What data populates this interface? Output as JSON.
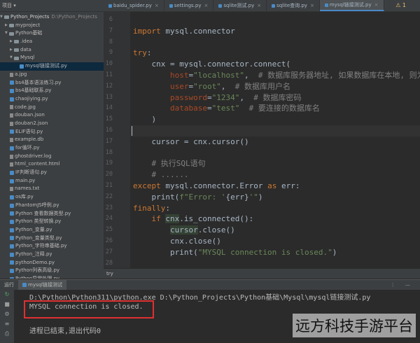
{
  "sidebar": {
    "header": "项目 ▾",
    "root": {
      "name": "Python_Projects",
      "path": "D:\\Python_Projects"
    },
    "items": [
      {
        "label": "myproject",
        "kind": "folder",
        "indent": 1,
        "expanded": false
      },
      {
        "label": "Python基础",
        "kind": "folder",
        "indent": 1,
        "expanded": true
      },
      {
        "label": ".idea",
        "kind": "folder",
        "indent": 2,
        "expanded": false
      },
      {
        "label": "data",
        "kind": "folder",
        "indent": 2,
        "expanded": false
      },
      {
        "label": "Mysql",
        "kind": "folder",
        "indent": 2,
        "expanded": true
      },
      {
        "label": "mysql链接测试.py",
        "kind": "py",
        "indent": 4,
        "selected": true
      },
      {
        "label": "a.jpg",
        "kind": "file",
        "indent": 2
      },
      {
        "label": "bs4基本语法练习.py",
        "kind": "py",
        "indent": 2
      },
      {
        "label": "bs4基础联系.py",
        "kind": "py",
        "indent": 2
      },
      {
        "label": "chaojiying.py",
        "kind": "py",
        "indent": 2
      },
      {
        "label": "code.jpg",
        "kind": "file",
        "indent": 2
      },
      {
        "label": "douban.json",
        "kind": "file",
        "indent": 2
      },
      {
        "label": "douban2.json",
        "kind": "file",
        "indent": 2
      },
      {
        "label": "ELIF语句.py",
        "kind": "py",
        "indent": 2
      },
      {
        "label": "example.db",
        "kind": "file",
        "indent": 2
      },
      {
        "label": "for循环.py",
        "kind": "py",
        "indent": 2
      },
      {
        "label": "ghostdriver.log",
        "kind": "file",
        "indent": 2
      },
      {
        "label": "html_content.html",
        "kind": "file",
        "indent": 2
      },
      {
        "label": "IF判断语句.py",
        "kind": "py",
        "indent": 2
      },
      {
        "label": "main.py",
        "kind": "py",
        "indent": 2
      },
      {
        "label": "names.txt",
        "kind": "file",
        "indent": 2
      },
      {
        "label": "os库.py",
        "kind": "py",
        "indent": 2
      },
      {
        "label": "PhantomJS呼例.py",
        "kind": "py",
        "indent": 2
      },
      {
        "label": "Python 查看数据类型.py",
        "kind": "py",
        "indent": 2
      },
      {
        "label": "Python 类型转换.py",
        "kind": "py",
        "indent": 2
      },
      {
        "label": "Python_变量.py",
        "kind": "py",
        "indent": 2
      },
      {
        "label": "Python_变量类型.py",
        "kind": "py",
        "indent": 2
      },
      {
        "label": "Python_字符串基础.py",
        "kind": "py",
        "indent": 2
      },
      {
        "label": "Python_注释.py",
        "kind": "py",
        "indent": 2
      },
      {
        "label": "pythonDemo.py",
        "kind": "py",
        "indent": 2
      },
      {
        "label": "Python列表高级.py",
        "kind": "py",
        "indent": 2
      },
      {
        "label": "Python异常处理.py",
        "kind": "py",
        "indent": 2
      }
    ]
  },
  "tabs": [
    {
      "label": "baidu_spider.py",
      "active": false
    },
    {
      "label": "settings.py",
      "active": false
    },
    {
      "label": "sqlite测试.py",
      "active": false
    },
    {
      "label": "sqlite查询.py",
      "active": false
    },
    {
      "label": "mysql链接测试.py",
      "active": true
    }
  ],
  "warning_badge": "⚠ 1",
  "editor": {
    "lines": [
      {
        "no": "6",
        "tokens": []
      },
      {
        "no": "7",
        "tokens": [
          {
            "t": "import",
            "c": "kw"
          },
          {
            "t": " mysql.connector"
          }
        ]
      },
      {
        "no": "8",
        "tokens": []
      },
      {
        "no": "9",
        "tokens": [
          {
            "t": "try",
            "c": "kw"
          },
          {
            "t": ":"
          }
        ]
      },
      {
        "no": "10",
        "tokens": [
          {
            "t": "    cnx = mysql.connector.connect("
          }
        ]
      },
      {
        "no": "11",
        "tokens": [
          {
            "t": "        "
          },
          {
            "t": "host",
            "c": "param"
          },
          {
            "t": "="
          },
          {
            "t": "\"localhost\"",
            "c": "str"
          },
          {
            "t": ",  "
          },
          {
            "t": "# 数据库服务器地址, 如果数据库在本地, 则为lo",
            "c": "cmt"
          }
        ]
      },
      {
        "no": "12",
        "tokens": [
          {
            "t": "        "
          },
          {
            "t": "user",
            "c": "param"
          },
          {
            "t": "="
          },
          {
            "t": "\"root\"",
            "c": "str"
          },
          {
            "t": ",  "
          },
          {
            "t": "# 数据库用户名",
            "c": "cmt"
          }
        ]
      },
      {
        "no": "13",
        "tokens": [
          {
            "t": "        "
          },
          {
            "t": "password",
            "c": "param"
          },
          {
            "t": "="
          },
          {
            "t": "\"1234\"",
            "c": "str"
          },
          {
            "t": ",  "
          },
          {
            "t": "# 数据库密码",
            "c": "cmt"
          }
        ]
      },
      {
        "no": "14",
        "tokens": [
          {
            "t": "        "
          },
          {
            "t": "database",
            "c": "param"
          },
          {
            "t": "="
          },
          {
            "t": "\"test\"",
            "c": "str"
          },
          {
            "t": "  "
          },
          {
            "t": "# 要连接的数据库名",
            "c": "cmt"
          }
        ]
      },
      {
        "no": "15",
        "tokens": [
          {
            "t": "    )"
          }
        ]
      },
      {
        "no": "16",
        "tokens": [],
        "current": true
      },
      {
        "no": "17",
        "tokens": [
          {
            "t": "    cursor = cnx.cursor()"
          }
        ]
      },
      {
        "no": "18",
        "tokens": []
      },
      {
        "no": "19",
        "tokens": [
          {
            "t": "    "
          },
          {
            "t": "# 执行SQL语句",
            "c": "cmt"
          }
        ]
      },
      {
        "no": "20",
        "tokens": [
          {
            "t": "    "
          },
          {
            "t": "# ......",
            "c": "cmt"
          }
        ]
      },
      {
        "no": "21",
        "tokens": [
          {
            "t": "except",
            "c": "kw"
          },
          {
            "t": " mysql.connector.Error "
          },
          {
            "t": "as",
            "c": "kw"
          },
          {
            "t": " err:"
          }
        ]
      },
      {
        "no": "22",
        "tokens": [
          {
            "t": "    print("
          },
          {
            "t": "f\"Error: '",
            "c": "str"
          },
          {
            "t": "{err}"
          },
          {
            "t": "'\"",
            "c": "str"
          },
          {
            "t": ")"
          }
        ]
      },
      {
        "no": "23",
        "tokens": [
          {
            "t": "finally",
            "c": "kw"
          },
          {
            "t": ":"
          }
        ]
      },
      {
        "no": "24",
        "tokens": [
          {
            "t": "    "
          },
          {
            "t": "if",
            "c": "kw"
          },
          {
            "t": " "
          },
          {
            "t": "cnx",
            "c": "hl"
          },
          {
            "t": ".is_connected():"
          }
        ]
      },
      {
        "no": "25",
        "tokens": [
          {
            "t": "        "
          },
          {
            "t": "cursor",
            "c": "hl"
          },
          {
            "t": ".close()"
          }
        ]
      },
      {
        "no": "26",
        "tokens": [
          {
            "t": "        cnx.close()"
          }
        ]
      },
      {
        "no": "27",
        "tokens": [
          {
            "t": "        print("
          },
          {
            "t": "\"MYSQL connection is closed.\"",
            "c": "str"
          },
          {
            "t": ")"
          }
        ]
      },
      {
        "no": "28",
        "tokens": []
      }
    ]
  },
  "breadcrumb": "try",
  "run": {
    "label": "运行",
    "tab": "mysql链接测试",
    "tools": "⋮ —",
    "command": "D:\\Python\\Python311\\python.exe D:\\Python_Projects\\Python基础\\Mysql\\mysql链接测试.py",
    "output": "MYSQL connection is closed.",
    "exit": "进程已结束,退出代码0"
  },
  "watermark": "远方科技手游平台",
  "colors": {
    "accent": "#4a88c7",
    "highlight_box": "#e03030"
  }
}
